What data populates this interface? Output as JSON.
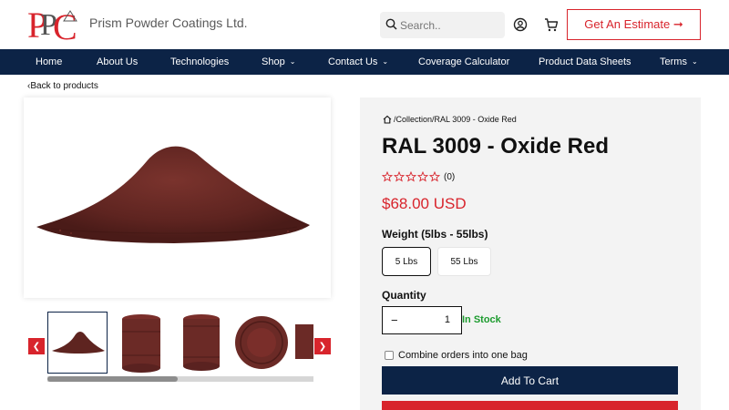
{
  "brand": {
    "logo_text": "PPC",
    "name": "Prism Powder Coatings Ltd."
  },
  "header": {
    "search_placeholder": "Search..",
    "estimate_label": "Get An Estimate ➞"
  },
  "nav": {
    "items": [
      {
        "label": "Home",
        "has_dropdown": false
      },
      {
        "label": "About Us",
        "has_dropdown": false
      },
      {
        "label": "Technologies",
        "has_dropdown": false
      },
      {
        "label": "Shop",
        "has_dropdown": true
      },
      {
        "label": "Contact Us",
        "has_dropdown": true
      },
      {
        "label": "Coverage Calculator",
        "has_dropdown": false
      },
      {
        "label": "Product Data Sheets",
        "has_dropdown": false
      },
      {
        "label": "Terms",
        "has_dropdown": true
      }
    ]
  },
  "back_link": "Back to products",
  "breadcrumb": {
    "path": "/Collection/RAL 3009 - Oxide Red"
  },
  "product": {
    "title": "RAL 3009 - Oxide Red",
    "rating": 0,
    "review_count": "(0)",
    "price": "$68.00 USD",
    "weight_label": "Weight (5lbs - 55lbs)",
    "weight_options": [
      "5 Lbs",
      "55 Lbs"
    ],
    "selected_weight": "5 Lbs",
    "quantity_label": "Quantity",
    "quantity_minus": "−",
    "quantity_value": "1",
    "stock_status": "In Stock",
    "combine_label": "Combine orders into one bag",
    "add_to_cart_label": "Add To Cart"
  },
  "gallery": {
    "thumbnails": [
      "powder-pile",
      "pail-front",
      "pail-side",
      "pail-lid",
      "pail-partial"
    ],
    "active_index": 0,
    "scroll_fraction": 0.49
  },
  "colors": {
    "navy": "#0c2346",
    "brand_red": "#d8242c",
    "in_stock_green": "#1c9b2e",
    "powder": "#6b2a26"
  }
}
